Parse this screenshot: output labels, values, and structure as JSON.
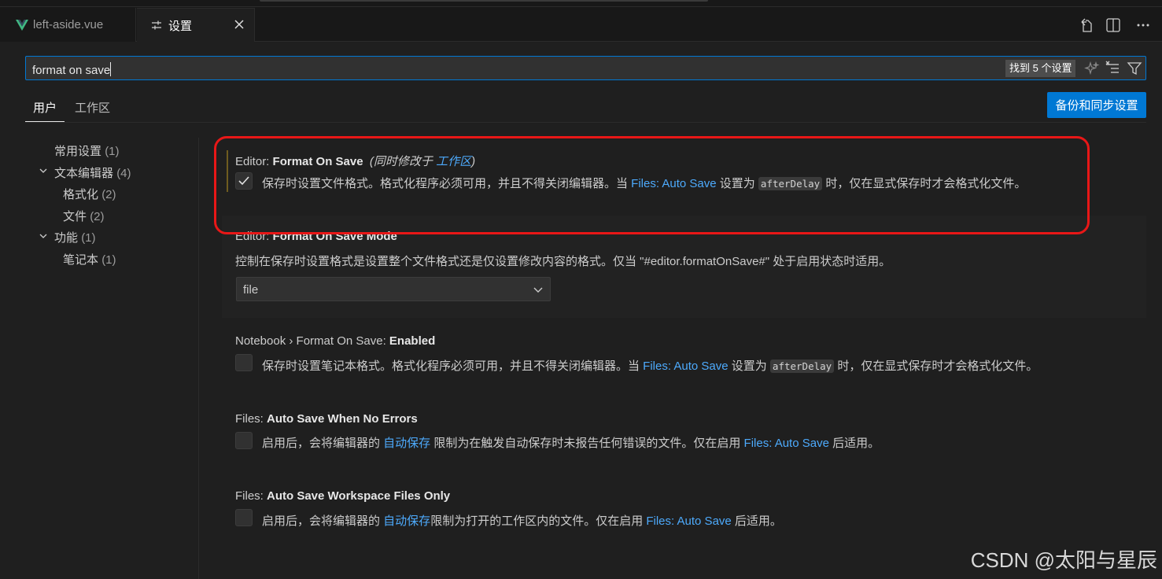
{
  "tabs": [
    {
      "label": "left-aside.vue",
      "icon": "vue-icon",
      "active": false
    },
    {
      "label": "设置",
      "icon": "settings-icon",
      "active": true
    }
  ],
  "search": {
    "value": "format on save",
    "result_count": "找到 5 个设置"
  },
  "scopes": {
    "user": "用户",
    "workspace": "工作区"
  },
  "sync_button": "备份和同步设置",
  "toc": [
    {
      "label": "常用设置",
      "count": "(1)"
    },
    {
      "label": "文本编辑器",
      "count": "(4)"
    },
    {
      "label": "格式化",
      "count": "(2)"
    },
    {
      "label": "文件",
      "count": "(2)"
    },
    {
      "label": "功能",
      "count": "(1)"
    },
    {
      "label": "笔记本",
      "count": "(1)"
    }
  ],
  "settings": {
    "s1": {
      "category": "Editor: ",
      "name": "Format On Save",
      "modified_note_prefix": "(同时修改于 ",
      "modified_note_link": "工作区",
      "modified_note_suffix": ")",
      "checked": true,
      "desc_a": "保存时设置文件格式。格式化程序必须可用，并且不得关闭编辑器。当 ",
      "desc_link": "Files: Auto Save",
      "desc_b": " 设置为 ",
      "desc_code": "afterDelay",
      "desc_c": " 时，仅在显式保存时才会格式化文件。"
    },
    "s2": {
      "category": "Editor: ",
      "name": "Format On Save Mode",
      "desc": "控制在保存时设置格式是设置整个文件格式还是仅设置修改内容的格式。仅当 \"#editor.formatOnSave#\" 处于启用状态时适用。",
      "select_value": "file"
    },
    "s3": {
      "category": "Notebook › Format On Save: ",
      "name": "Enabled",
      "checked": false,
      "desc_a": "保存时设置笔记本格式。格式化程序必须可用，并且不得关闭编辑器。当 ",
      "desc_link": "Files: Auto Save",
      "desc_b": " 设置为 ",
      "desc_code": "afterDelay",
      "desc_c": " 时，仅在显式保存时才会格式化文件。"
    },
    "s4": {
      "category": "Files: ",
      "name": "Auto Save When No Errors",
      "checked": false,
      "desc_a": "启用后，会将编辑器的 ",
      "desc_link1": "自动保存",
      "desc_b": " 限制为在触发自动保存时未报告任何错误的文件。仅在启用 ",
      "desc_link2": "Files: Auto Save",
      "desc_c": " 后适用。"
    },
    "s5": {
      "category": "Files: ",
      "name": "Auto Save Workspace Files Only",
      "checked": false,
      "desc_a": "启用后，会将编辑器的 ",
      "desc_link1": "自动保存",
      "desc_b": "限制为打开的工作区内的文件。仅在启用 ",
      "desc_link2": "Files: Auto Save",
      "desc_c": " 后适用。"
    }
  },
  "watermark": "CSDN @太阳与星辰",
  "colors": {
    "accent": "#0078d4",
    "link": "#4daafc",
    "highlight": "#e81717"
  }
}
